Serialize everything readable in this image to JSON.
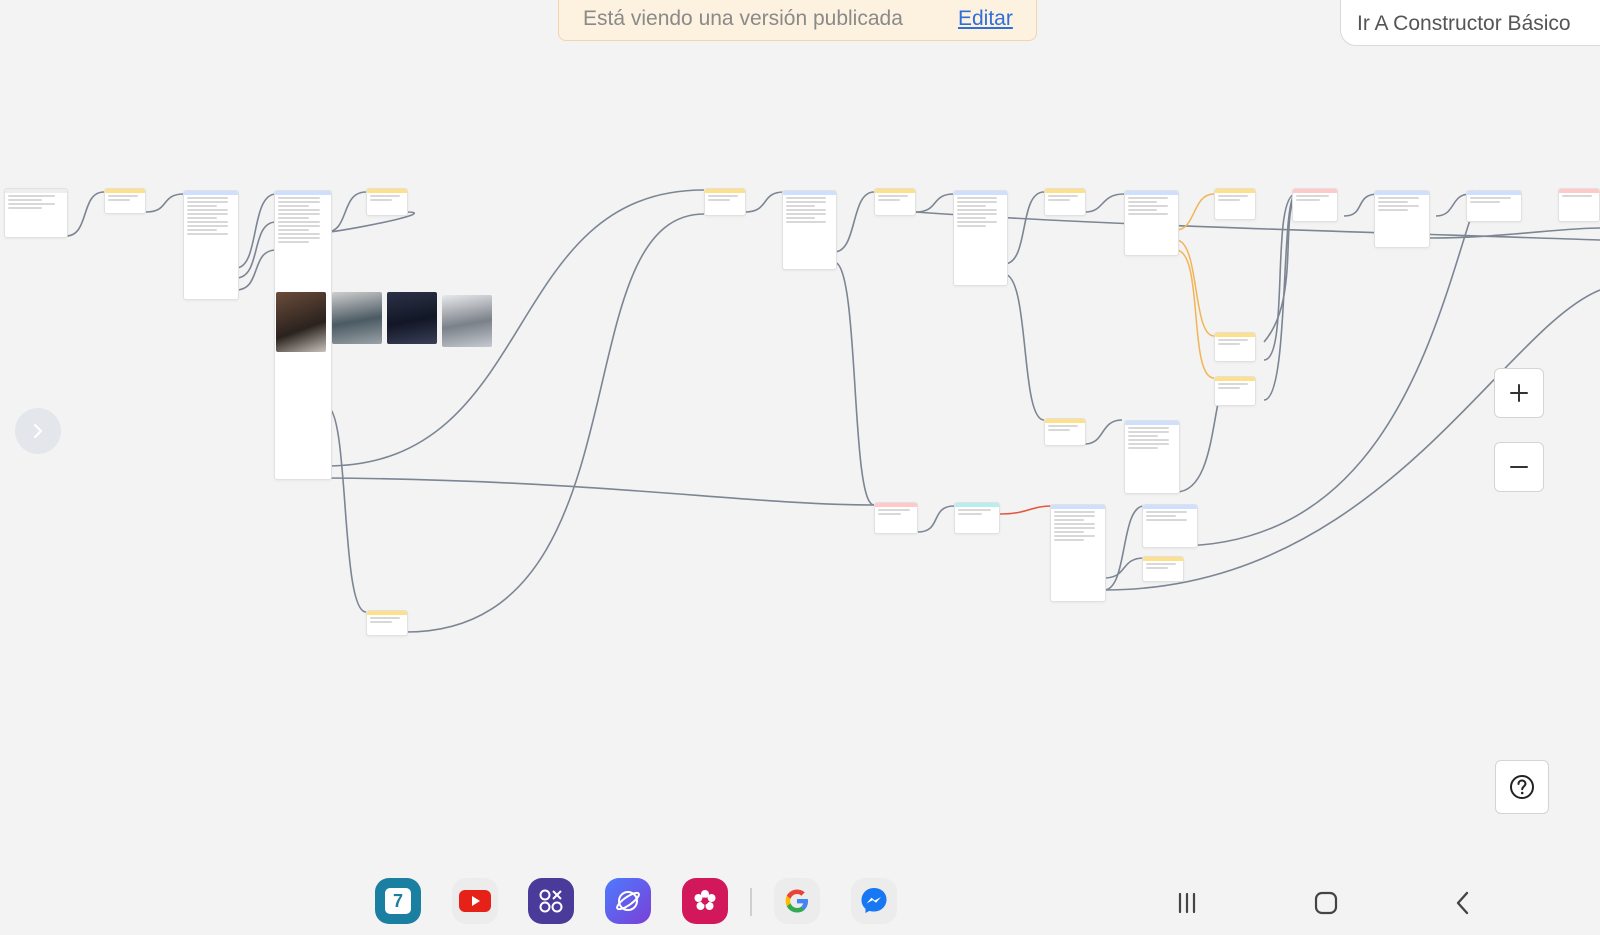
{
  "banner": {
    "message": "Está viendo una versión publicada",
    "edit_label": "Editar"
  },
  "builder_button": {
    "label": "Ir A Constructor Básico"
  },
  "controls": {
    "zoom_in": "+",
    "zoom_out": "−",
    "help": "?"
  },
  "calendar_app": {
    "day": "7"
  },
  "colors": {
    "bg": "#f3f3f3",
    "edge": "#7b8593",
    "edge_orange": "#f2b455",
    "edge_red": "#e0593e",
    "link": "#2f6fdb"
  },
  "dock": {
    "apps": [
      "calendar-app-icon",
      "youtube-app-icon",
      "apps-folder-icon",
      "browser-app-icon",
      "gallery-app-icon",
      "google-app-icon",
      "messenger-app-icon"
    ],
    "nav": [
      "recents-icon",
      "home-icon",
      "back-icon"
    ]
  }
}
